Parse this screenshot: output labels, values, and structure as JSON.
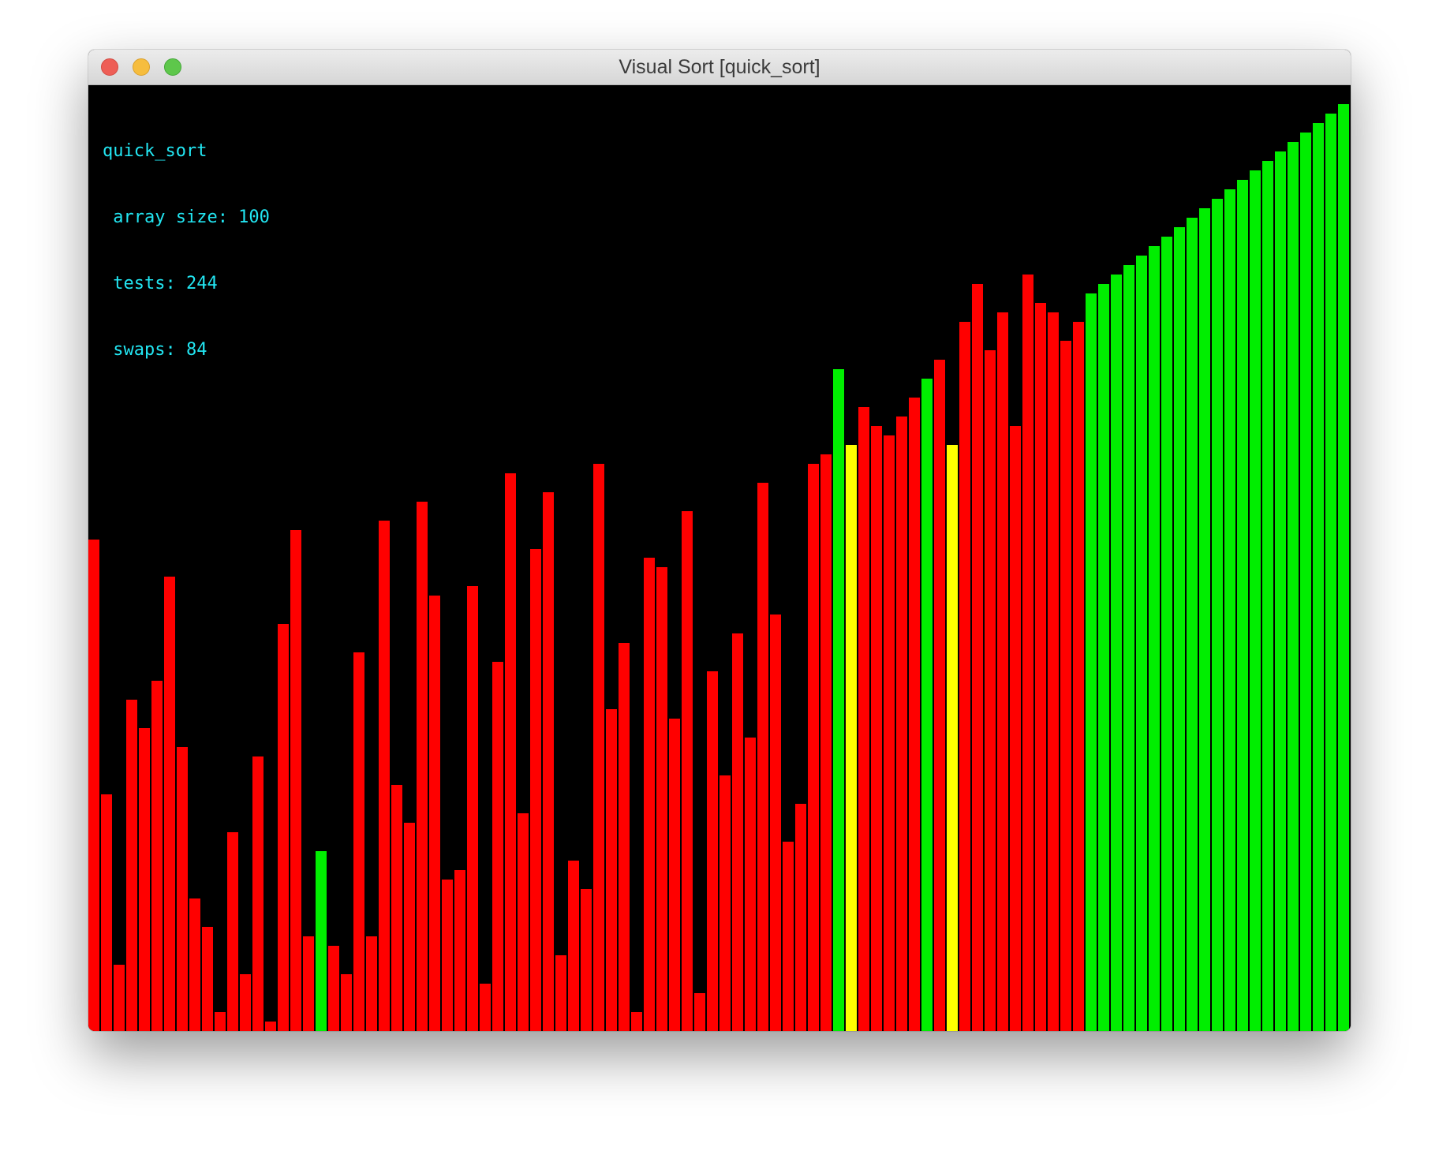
{
  "window": {
    "title": "Visual Sort [quick_sort]"
  },
  "stats": {
    "algorithm": "quick_sort",
    "array_size": " array size: 100",
    "tests": " tests: 244",
    "swaps": " swaps: 84"
  },
  "colors": {
    "background": "#000000",
    "unsorted": "#ff0000",
    "sorted": "#00ee00",
    "active": "#ffff00",
    "overlay_text": "#22e6f2"
  },
  "chart_data": {
    "type": "bar",
    "values": [
      52,
      25,
      7,
      35,
      32,
      37,
      48,
      30,
      14,
      11,
      2,
      21,
      6,
      29,
      1,
      43,
      53,
      10,
      19,
      9,
      6,
      40,
      10,
      54,
      26,
      22,
      56,
      46,
      16,
      17,
      47,
      5,
      39,
      59,
      23,
      51,
      57,
      8,
      18,
      15,
      60,
      34,
      41,
      2,
      50,
      49,
      33,
      55,
      4,
      38,
      27,
      42,
      31,
      58,
      44,
      20,
      24,
      60,
      61,
      70,
      62,
      66,
      64,
      63,
      65,
      67,
      69,
      71,
      62,
      75,
      79,
      72,
      76,
      64,
      80,
      77,
      76,
      73,
      75,
      78,
      79,
      80,
      81,
      82,
      83,
      84,
      85,
      86,
      87,
      88,
      89,
      90,
      91,
      92,
      93,
      94,
      95,
      96,
      97,
      98
    ],
    "states": [
      "u",
      "u",
      "u",
      "u",
      "u",
      "u",
      "u",
      "u",
      "u",
      "u",
      "u",
      "u",
      "u",
      "u",
      "u",
      "u",
      "u",
      "u",
      "s",
      "u",
      "u",
      "u",
      "u",
      "u",
      "u",
      "u",
      "u",
      "u",
      "u",
      "u",
      "u",
      "u",
      "u",
      "u",
      "u",
      "u",
      "u",
      "u",
      "u",
      "u",
      "u",
      "u",
      "u",
      "u",
      "u",
      "u",
      "u",
      "u",
      "u",
      "u",
      "u",
      "u",
      "u",
      "u",
      "u",
      "u",
      "u",
      "u",
      "u",
      "s",
      "a",
      "u",
      "u",
      "u",
      "u",
      "u",
      "s",
      "u",
      "a",
      "u",
      "u",
      "u",
      "u",
      "u",
      "u",
      "u",
      "u",
      "u",
      "u",
      "s",
      "s",
      "s",
      "s",
      "s",
      "s",
      "s",
      "s",
      "s",
      "s",
      "s",
      "s",
      "s",
      "s",
      "s",
      "s",
      "s",
      "s",
      "s",
      "s",
      "s"
    ],
    "state_legend": {
      "u": "unsorted",
      "s": "sorted",
      "a": "active"
    },
    "ylim": [
      0,
      100
    ]
  }
}
